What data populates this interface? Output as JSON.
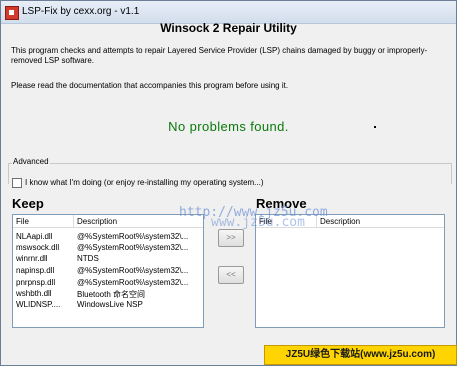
{
  "window": {
    "title": "LSP-Fix by cexx.org - v1.1",
    "heading": "Winsock 2 Repair Utility",
    "description": "This program checks and attempts to repair Layered Service Provider (LSP) chains damaged by buggy or improperly-removed LSP software.",
    "doc_note": "Please read the documentation that accompanies this program before using it.",
    "status": "No problems found."
  },
  "advanced": {
    "label": "Advanced",
    "checkbox_label": "I know what I'm doing (or enjoy re-installing my operating system...)"
  },
  "keep": {
    "title": "Keep",
    "columns": [
      "File",
      "Description"
    ],
    "rows": [
      {
        "file": "NLAapi.dll",
        "desc": "@%SystemRoot%\\system32\\..."
      },
      {
        "file": "mswsock.dll",
        "desc": "@%SystemRoot%\\system32\\..."
      },
      {
        "file": "winrnr.dll",
        "desc": "NTDS"
      },
      {
        "file": "napinsp.dll",
        "desc": "@%SystemRoot%\\system32\\..."
      },
      {
        "file": "pnrpnsp.dll",
        "desc": "@%SystemRoot%\\system32\\..."
      },
      {
        "file": "wshbth.dll",
        "desc": "Bluetooth 命名空间"
      },
      {
        "file": "WLIDNSP....",
        "desc": "WindowsLive NSP"
      }
    ]
  },
  "remove": {
    "title": "Remove",
    "columns": [
      "File",
      "Description"
    ]
  },
  "buttons": {
    "move_right": ">>",
    "move_left": "<<"
  },
  "watermark": {
    "url_1": "http://www.jz5u.com",
    "url_2": "www.jz5u.com",
    "badge": "JZ5U绿色下载站(www.jz5u.com)"
  }
}
